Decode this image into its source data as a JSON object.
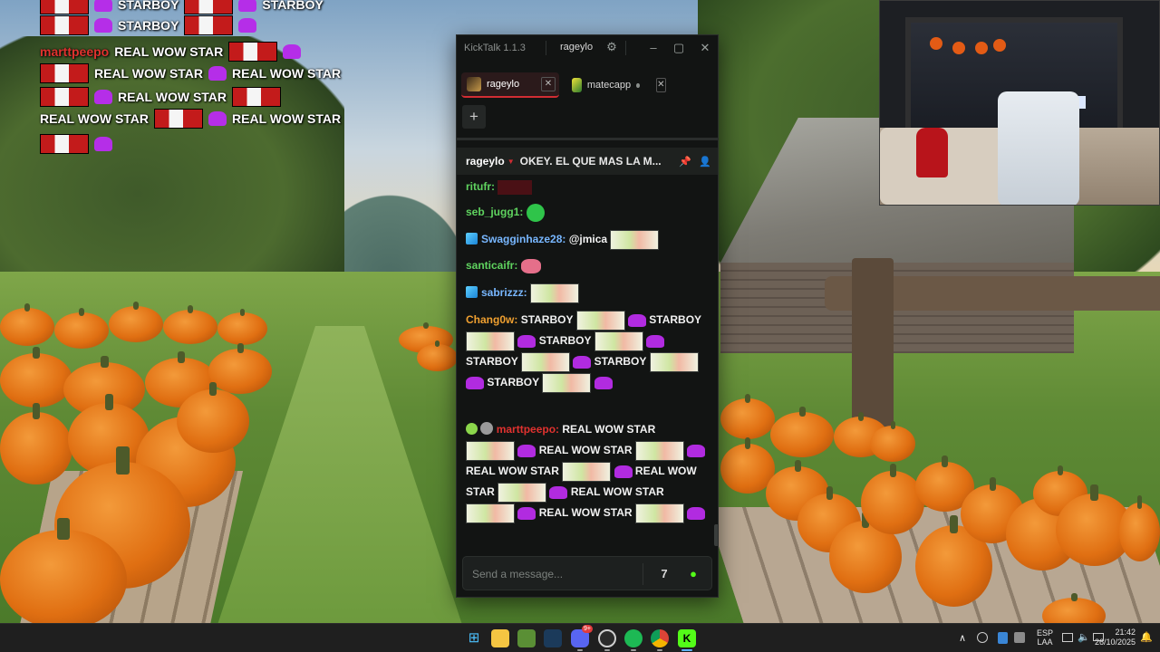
{
  "overlay": {
    "rows": [
      {
        "items": [
          "emote",
          "purple",
          "STARBOY",
          "emote",
          "purple",
          "STARBOY"
        ]
      },
      {
        "items": [
          "emote",
          "purple",
          "STARBOY",
          "emote",
          "purple"
        ]
      },
      {
        "user": "marttpeepo",
        "text": "REAL WOW STAR"
      },
      {
        "text1": "REAL WOW STAR",
        "text2": "REAL WOW STAR"
      },
      {
        "text1": "REAL WOW STAR"
      },
      {
        "text1": "REAL WOW STAR",
        "text2": "REAL WOW STAR"
      }
    ],
    "starboy": "STARBOY",
    "realwow": "REAL WOW STAR",
    "user": "marttpeepo"
  },
  "kicktalk": {
    "app_title": "KickTalk 1.1.3",
    "header_channel": "rageylo",
    "tabs": [
      {
        "label": "rageylo",
        "active": true
      },
      {
        "label": "matecapp",
        "active": false
      }
    ],
    "add_tab_label": "+",
    "pinned": {
      "user": "rageylo",
      "text": "OKEY. EL QUE MAS LA M..."
    },
    "messages": [
      {
        "user": "ritufr:",
        "color": "#5fd35f"
      },
      {
        "user": "seb_jugg1:",
        "color": "#5fd35f"
      },
      {
        "user": "Swagginhaze28:",
        "color": "#78b7ff",
        "text": "@jmica"
      },
      {
        "user": "santicaifr:",
        "color": "#5fd35f"
      },
      {
        "user": "sabrizzz:",
        "color": "#78b7ff"
      },
      {
        "user": "Chang0w:",
        "color": "#f0a030",
        "starboy": "STARBOY"
      },
      {
        "user": "marttpeepo:",
        "color": "#e0322f",
        "realwow": "REAL WOW STAR",
        "real": "REAL",
        "wowstar": "WOW STAR"
      }
    ],
    "input_placeholder": "Send a message..."
  },
  "taskbar": {
    "lang_top": "ESP",
    "lang_bottom": "LAA",
    "time": "21:42",
    "date": "26/10/2025",
    "icons": [
      "windows-start-icon",
      "file-explorer-icon",
      "minecraft-icon",
      "steam-icon",
      "discord-icon",
      "obs-icon",
      "spotify-icon",
      "chrome-icon",
      "kick-icon"
    ],
    "discord_badge": "9+"
  },
  "colors": {
    "kick_green": "#53fc18",
    "accent_red": "#d12d33",
    "window_bg": "#121413"
  }
}
